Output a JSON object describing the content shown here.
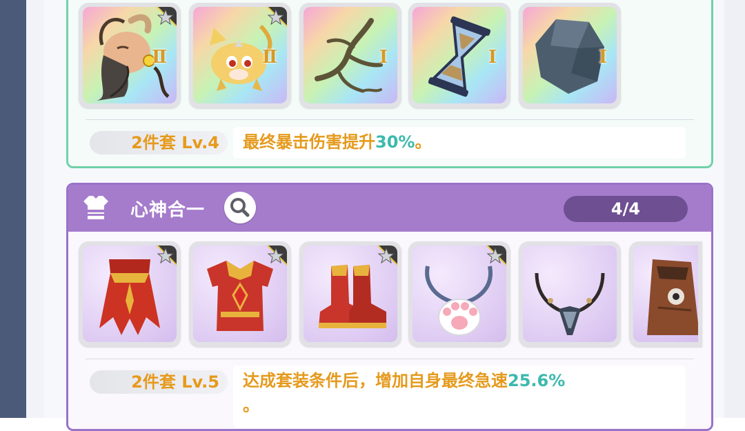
{
  "set1": {
    "items": [
      {
        "name": "goat-mask",
        "tier": "Ⅱ",
        "star": true,
        "bg": "rainbow"
      },
      {
        "name": "yellow-dragon",
        "tier": "Ⅱ",
        "star": true,
        "bg": "rainbow"
      },
      {
        "name": "dark-branch",
        "tier": "Ⅰ",
        "star": false,
        "bg": "rainbow"
      },
      {
        "name": "hourglass",
        "tier": "Ⅰ",
        "star": false,
        "bg": "rainbow"
      },
      {
        "name": "dark-stone",
        "tier": "Ⅰ",
        "star": false,
        "bg": "rainbow"
      }
    ],
    "bonus": {
      "level_label": "2件套 Lv.4",
      "text": "最终暴击伤害提升",
      "value": "30%",
      "suffix": "。"
    }
  },
  "set2": {
    "name": "心神合一",
    "count": "4/4",
    "items": [
      {
        "name": "red-gold-cape",
        "star": true,
        "bg": "purple"
      },
      {
        "name": "red-gold-armor",
        "star": true,
        "bg": "purple"
      },
      {
        "name": "red-gold-boots",
        "star": true,
        "bg": "purple"
      },
      {
        "name": "paw-pendant",
        "star": true,
        "bg": "purple"
      },
      {
        "name": "dark-necklace",
        "star": false,
        "bg": "purple"
      },
      {
        "name": "wooden-totem",
        "star": false,
        "bg": "purple"
      }
    ],
    "bonus": {
      "level_label": "2件套 Lv.5",
      "text": "达成套装条件后，增加自身最终急速",
      "value": "25.6%",
      "suffix": "。"
    }
  },
  "colors": {
    "set1_border": "#6fd1a9",
    "set2_border": "#9a72c9",
    "set2_header": "#a57ccc",
    "accent_orange": "#e59a1d",
    "accent_teal": "#3db9ae"
  }
}
